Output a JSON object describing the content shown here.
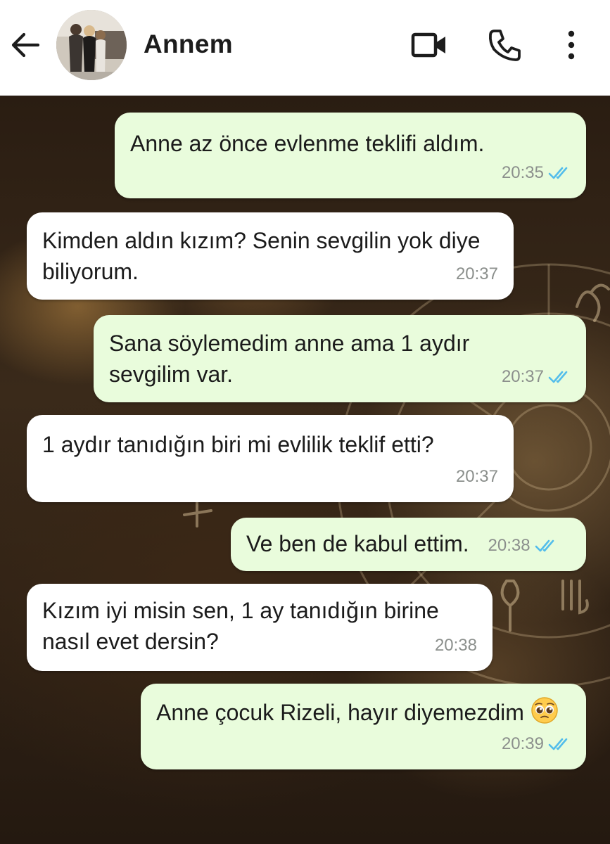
{
  "header": {
    "contact_name": "Annem",
    "icons": {
      "back": "arrow-left-icon",
      "video": "video-camera-icon",
      "call": "phone-icon",
      "more": "more-vertical-icon"
    }
  },
  "messages": [
    {
      "direction": "outgoing",
      "text": "Anne az önce evlenme teklifi aldım.",
      "time": "20:35",
      "status": "read"
    },
    {
      "direction": "incoming",
      "text": "Kimden aldın kızım? Senin sevgilin yok diye biliyorum.",
      "time": "20:37"
    },
    {
      "direction": "outgoing",
      "text": "Sana söylemedim anne ama 1 aydır sevgilim var.",
      "time": "20:37",
      "status": "read"
    },
    {
      "direction": "incoming",
      "text": "1 aydır tanıdığın biri mi evlilik teklif etti?",
      "time": "20:37"
    },
    {
      "direction": "outgoing",
      "text": "Ve ben de kabul ettim.",
      "time": "20:38",
      "status": "read"
    },
    {
      "direction": "incoming",
      "text": "Kızım iyi misin sen, 1 ay tanıdığın birine nasıl evet dersin?",
      "time": "20:38"
    },
    {
      "direction": "outgoing",
      "text": "Anne çocuk Rizeli, hayır diyemezdim",
      "emoji": "pleading-face-emoji",
      "time": "20:39",
      "status": "read"
    }
  ],
  "colors": {
    "outgoing_bubble": "#e9fcdc",
    "incoming_bubble": "#ffffff",
    "read_ticks": "#53bdeb",
    "timestamp": "#8b8f8c"
  }
}
